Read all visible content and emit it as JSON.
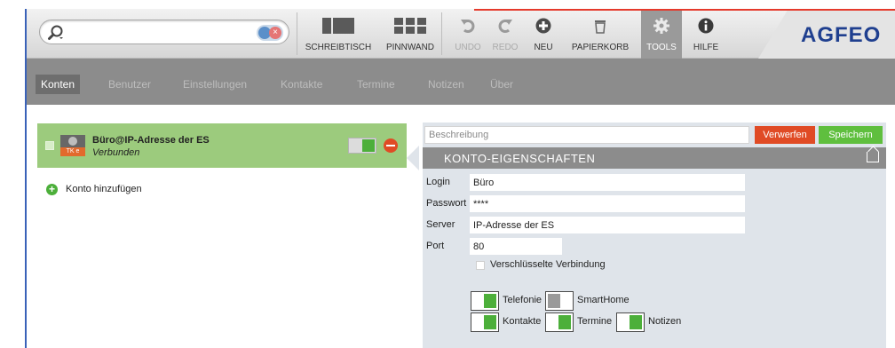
{
  "toolbar": {
    "search": {
      "value": "",
      "placeholder": ""
    },
    "buttons": [
      {
        "id": "schreibtisch",
        "label": "SCHREIBTISCH",
        "icon": "desk-icon",
        "enabled": true
      },
      {
        "id": "pinnwand",
        "label": "PINNWAND",
        "icon": "grid-icon",
        "enabled": true
      },
      {
        "id": "undo",
        "label": "UNDO",
        "icon": "undo-icon",
        "enabled": false
      },
      {
        "id": "redo",
        "label": "REDO",
        "icon": "redo-icon",
        "enabled": false
      },
      {
        "id": "neu",
        "label": "NEU",
        "icon": "plus-circle-icon",
        "enabled": true
      },
      {
        "id": "papierkorb",
        "label": "PAPIERKORB",
        "icon": "trash-icon",
        "enabled": true
      },
      {
        "id": "tools",
        "label": "TOOLS",
        "icon": "gear-icon",
        "enabled": true,
        "active": true
      },
      {
        "id": "hilfe",
        "label": "HILFE",
        "icon": "info-icon",
        "enabled": true
      }
    ],
    "logo": "AGFEO"
  },
  "nav": {
    "tabs": [
      {
        "label": "Konten",
        "active": true
      },
      {
        "label": "Benutzer",
        "active": false
      },
      {
        "label": "Einstellungen",
        "active": false
      },
      {
        "label": "Kontakte",
        "active": false
      },
      {
        "label": "Termine",
        "active": false
      },
      {
        "label": "Notizen",
        "active": false
      },
      {
        "label": "Über",
        "active": false
      }
    ]
  },
  "accounts": {
    "items": [
      {
        "name": "Büro@IP-Adresse der ES",
        "status": "Verbunden",
        "logo_text": "TK e",
        "enabled": true
      }
    ],
    "add_label": "Konto hinzufügen"
  },
  "detail": {
    "description_placeholder": "Beschreibung",
    "discard_label": "Verwerfen",
    "save_label": "Speichern",
    "section_title": "KONTO-EIGENSCHAFTEN",
    "fields": {
      "login": {
        "label": "Login",
        "value": "Büro"
      },
      "password": {
        "label": "Passwort",
        "value": "****"
      },
      "server": {
        "label": "Server",
        "value": "IP-Adresse der ES"
      },
      "port": {
        "label": "Port",
        "value": "80"
      }
    },
    "encrypted": {
      "label": "Verschlüsselte Verbindung",
      "checked": false
    },
    "services": {
      "telefonie": {
        "label": "Telefonie",
        "on": true
      },
      "smarthome": {
        "label": "SmartHome",
        "on": false
      },
      "kontakte": {
        "label": "Kontakte",
        "on": true
      },
      "termine": {
        "label": "Termine",
        "on": true
      },
      "notizen": {
        "label": "Notizen",
        "on": true
      }
    }
  },
  "colors": {
    "accent_blue": "#1f3f8f",
    "selected_green": "#9ccb7d",
    "toggle_green": "#4caf3a",
    "discard_red": "#e04b25",
    "save_green": "#5fbf3e",
    "nav_gray": "#8c8c8c"
  }
}
